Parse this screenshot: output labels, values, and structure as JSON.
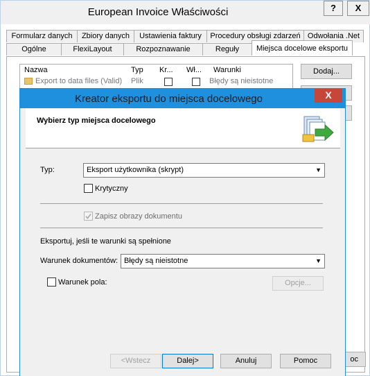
{
  "window": {
    "title": "European Invoice Właściwości",
    "help_label": "?",
    "close_label": "X"
  },
  "tabs_row1": [
    "Formularz danych",
    "Zbiory danych",
    "Ustawienia faktury",
    "Procedury obsługi zdarzeń",
    "Odwołania .Net"
  ],
  "tabs_row2": [
    "Ogólne",
    "FlexiLayout",
    "Rozpoznawanie",
    "Reguły",
    "Miejsca docelowe eksportu"
  ],
  "list": {
    "headers": [
      "Nazwa",
      "Typ",
      "Kr...",
      "Wł...",
      "Warunki"
    ],
    "row": {
      "name": "Export to data files (Valid)",
      "type": "Plik",
      "conditions": "Błędy są nieistotne"
    }
  },
  "side_buttons": {
    "add": "Dodaj...",
    "behind_help": "Pomoc"
  },
  "wizard": {
    "title": "Kreator eksportu do miejsca docelowego",
    "close_label": "X",
    "header": "Wybierz typ miejsca docelowego",
    "type_label": "Typ:",
    "type_value": "Eksport użytkownika (skrypt)",
    "critical_label": "Krytyczny",
    "save_images_label": "Zapisz obrazy dokumentu",
    "export_if_label": "Eksportuj, jeśli te warunki są spełnione",
    "doc_condition_label": "Warunek dokumentów:",
    "doc_condition_value": "Błędy są nieistotne",
    "field_condition_label": "Warunek pola:",
    "options_button": "Opcje...",
    "buttons": {
      "back": "<Wstecz",
      "next": "Dalej>",
      "cancel": "Anuluj",
      "help": "Pomoc"
    }
  }
}
